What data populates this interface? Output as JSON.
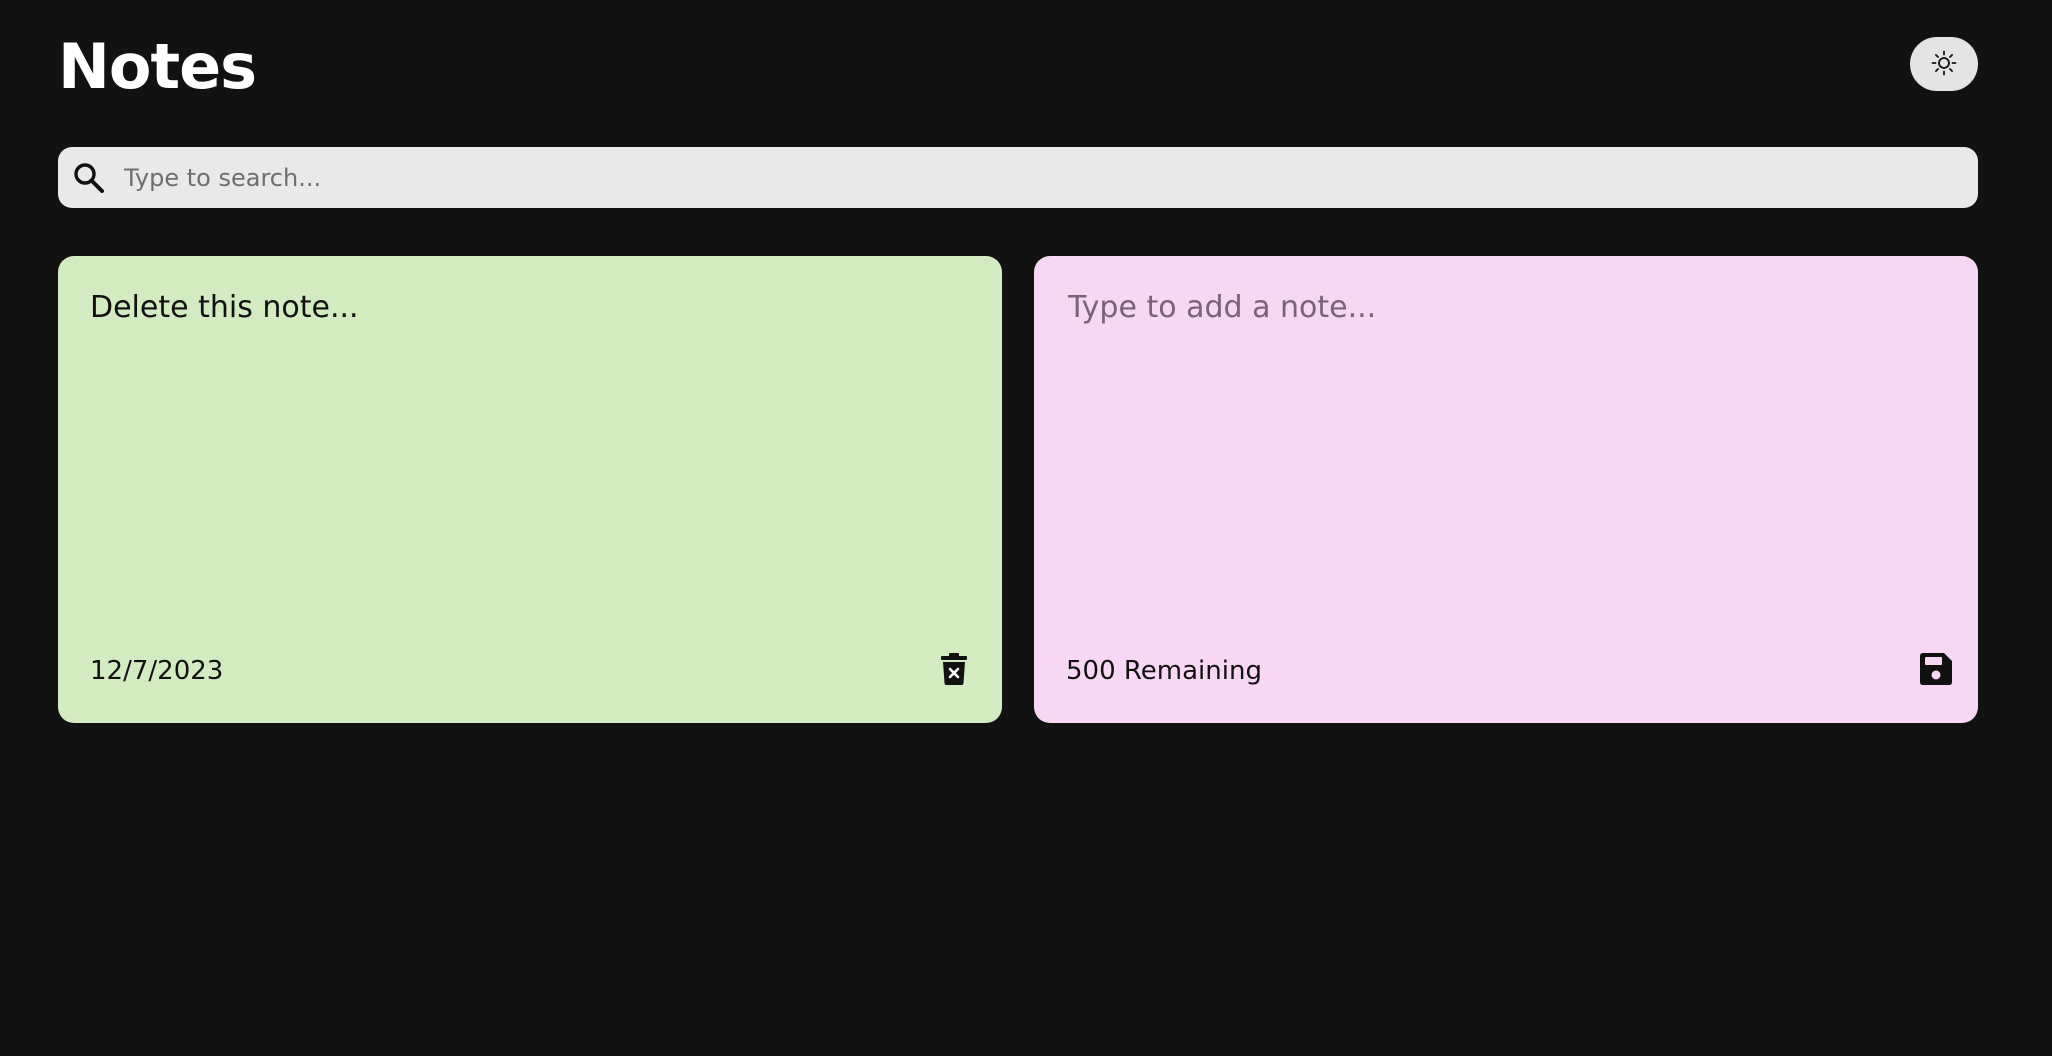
{
  "header": {
    "title": "Notes",
    "theme_toggle_icon": "sun-icon"
  },
  "search": {
    "placeholder": "Type to search...",
    "value": "",
    "icon": "search-icon"
  },
  "notes": [
    {
      "text": "Delete this note...",
      "date": "12/7/2023",
      "color": "#d2ebc0",
      "action_icon": "trash-icon"
    }
  ],
  "new_note": {
    "placeholder": "Type to add a note...",
    "value": "",
    "remaining_label": "500 Remaining",
    "color": "#f8d7f4",
    "action_icon": "save-icon"
  },
  "colors": {
    "background": "#121212",
    "search_background": "#e9e9e9",
    "toggle_background": "#e4e4e4"
  }
}
